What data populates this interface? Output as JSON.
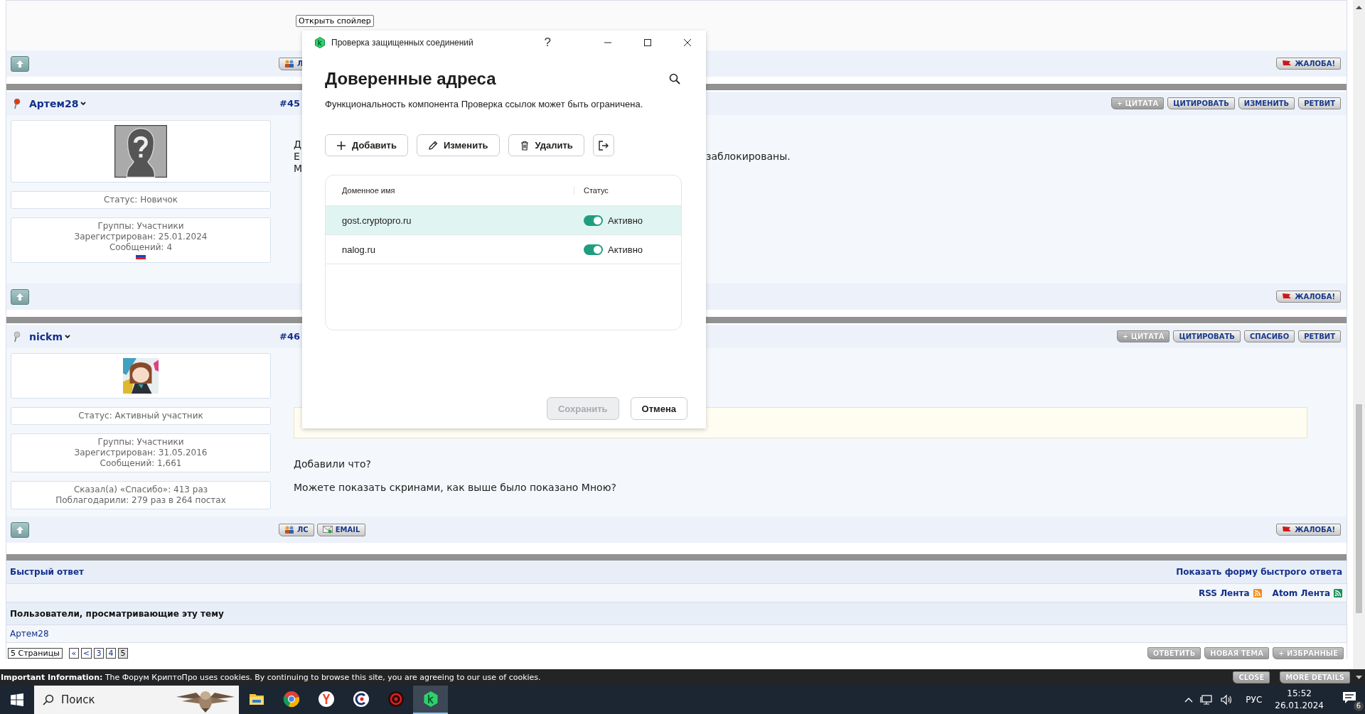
{
  "forum": {
    "top_post": {
      "spoiler_button": "Открыть спойлер",
      "pm_button": "Л",
      "report_button": "ЖАЛОБА!"
    },
    "posts": [
      {
        "user": "Артем28",
        "online": true,
        "number": "#45",
        "actions": [
          {
            "label": "+ ЦИТАТА",
            "muted": true
          },
          {
            "label": "ЦИТИРОВАТЬ",
            "muted": false
          },
          {
            "label": "ИЗМЕНИТЬ",
            "muted": false
          },
          {
            "label": "РЕТВИТ",
            "muted": false
          }
        ],
        "avatar": {
          "kind": "default"
        },
        "status": "Статус: Новичок",
        "info": [
          "Группы: Участники",
          "Зарегистрирован: 25.01.2024",
          "Сообщений: 4"
        ],
        "flag": true,
        "lines": [
          {
            "left": "Д"
          },
          {
            "left": "Е",
            "right": "заблокированы."
          },
          {
            "left": "М"
          }
        ],
        "report_button": "ЖАЛОБА!"
      },
      {
        "user": "nickm",
        "online": false,
        "number": "#46",
        "actions": [
          {
            "label": "+ ЦИТАТА",
            "muted": true
          },
          {
            "label": "ЦИТИРОВАТЬ",
            "muted": false
          },
          {
            "label": "СПАСИБО",
            "muted": false
          },
          {
            "label": "РЕТВИТ",
            "muted": false
          }
        ],
        "avatar": {
          "kind": "picture"
        },
        "status": "Статус: Активный участник",
        "info": [
          "Группы: Участники",
          "Зарегистрирован: 31.05.2016",
          "Сообщений: 1,661"
        ],
        "thanks": [
          "Сказал(а) «Спасибо»: 413 раз",
          "Поблагодарили: 279 раз в 264 постах"
        ],
        "quote": true,
        "paragraphs": [
          "Добавили что?",
          "Можете показать скринами, как выше было показано Мною?"
        ],
        "footer_buttons": [
          {
            "kind": "pm",
            "label": "ЛС"
          },
          {
            "kind": "email",
            "label": "EMAIL"
          }
        ],
        "report_button": "ЖАЛОБА!"
      }
    ],
    "quick_reply": {
      "title": "Быстрый ответ",
      "link": "Показать форму быстрого ответа"
    },
    "feeds": [
      {
        "kind": "rss",
        "label": "RSS Лента"
      },
      {
        "kind": "atom",
        "label": "Atom Лента"
      }
    ],
    "viewers": {
      "title": "Пользователи, просматривающие эту тему",
      "users": [
        "Артем28"
      ]
    },
    "pagination": {
      "label": "5 Страницы",
      "pages": [
        {
          "label": "«",
          "selected": false
        },
        {
          "label": "<",
          "selected": false
        },
        {
          "label": "3",
          "selected": false
        },
        {
          "label": "4",
          "selected": false
        },
        {
          "label": "5",
          "selected": true
        }
      ]
    },
    "topic_buttons": [
      "ОТВЕТИТЬ",
      "НОВАЯ ТЕМА",
      "+ ИЗБРАННЫЕ"
    ]
  },
  "cookie_bar": {
    "text": "**Important Information:** The Форум КриптоПро uses cookies. By continuing to browse this site, you are agreeing to our use of cookies.",
    "buttons": [
      "CLOSE",
      "MORE DETAILS"
    ]
  },
  "dialog": {
    "title": "Проверка защищенных соединений",
    "help": "?",
    "heading": "Доверенные адреса",
    "subtitle": "Функциональность компонента Проверка ссылок может быть ограничена.",
    "toolbar": [
      {
        "kind": "add",
        "label": "Добавить"
      },
      {
        "kind": "edit",
        "label": "Изменить"
      },
      {
        "kind": "delete",
        "label": "Удалить"
      },
      {
        "kind": "export"
      }
    ],
    "columns": [
      "Доменное имя",
      "Статус"
    ],
    "rows": [
      {
        "domain": "gost.cryptopro.ru",
        "on": true,
        "status": "Активно",
        "selected": true
      },
      {
        "domain": "nalog.ru",
        "on": true,
        "status": "Активно",
        "selected": false
      }
    ],
    "buttons": [
      {
        "label": "Сохранить",
        "disabled": true
      },
      {
        "label": "Отмена",
        "disabled": false
      }
    ]
  },
  "taskbar": {
    "search_placeholder": "Поиск",
    "apps": [
      {
        "kind": "explorer",
        "active": false
      },
      {
        "kind": "chrome",
        "active": false
      },
      {
        "kind": "yandex",
        "active": false
      },
      {
        "kind": "c",
        "active": false
      },
      {
        "kind": "red",
        "active": false
      },
      {
        "kind": "kaspersky",
        "active": true
      }
    ],
    "language": "РУС",
    "time": "15:52",
    "date": "26.01.2024",
    "notifications": "6"
  }
}
